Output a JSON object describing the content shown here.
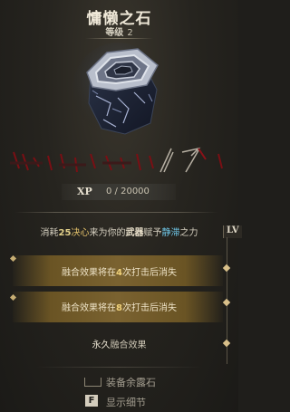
{
  "item": {
    "name": "慵懒之石",
    "level_label": "等级",
    "level_value": "2"
  },
  "xp": {
    "label": "XP",
    "value": "0 / 20000"
  },
  "description": {
    "prefix": "消耗",
    "amount": "25",
    "resource": "决心",
    "mid1": "来为你的",
    "weapon": "武器",
    "mid2": "赋予",
    "effect": "静滞",
    "suffix": "之力"
  },
  "level_tab": "LV",
  "effects": [
    {
      "pre": "融合效果将在",
      "num": "4",
      "post": "次打击后消失"
    },
    {
      "pre": "融合效果将在",
      "num": "8",
      "post": "次打击后消失"
    }
  ],
  "permanent": {
    "pre": "永久",
    "post": "融合效果"
  },
  "footer": {
    "equip_label": "装备余露石",
    "details_key": "F",
    "details_label": "显示细节"
  },
  "colors": {
    "accent_gold": "#e2c06a",
    "stasis_blue": "#6fc7e8",
    "effect_row": "#7a6230"
  }
}
